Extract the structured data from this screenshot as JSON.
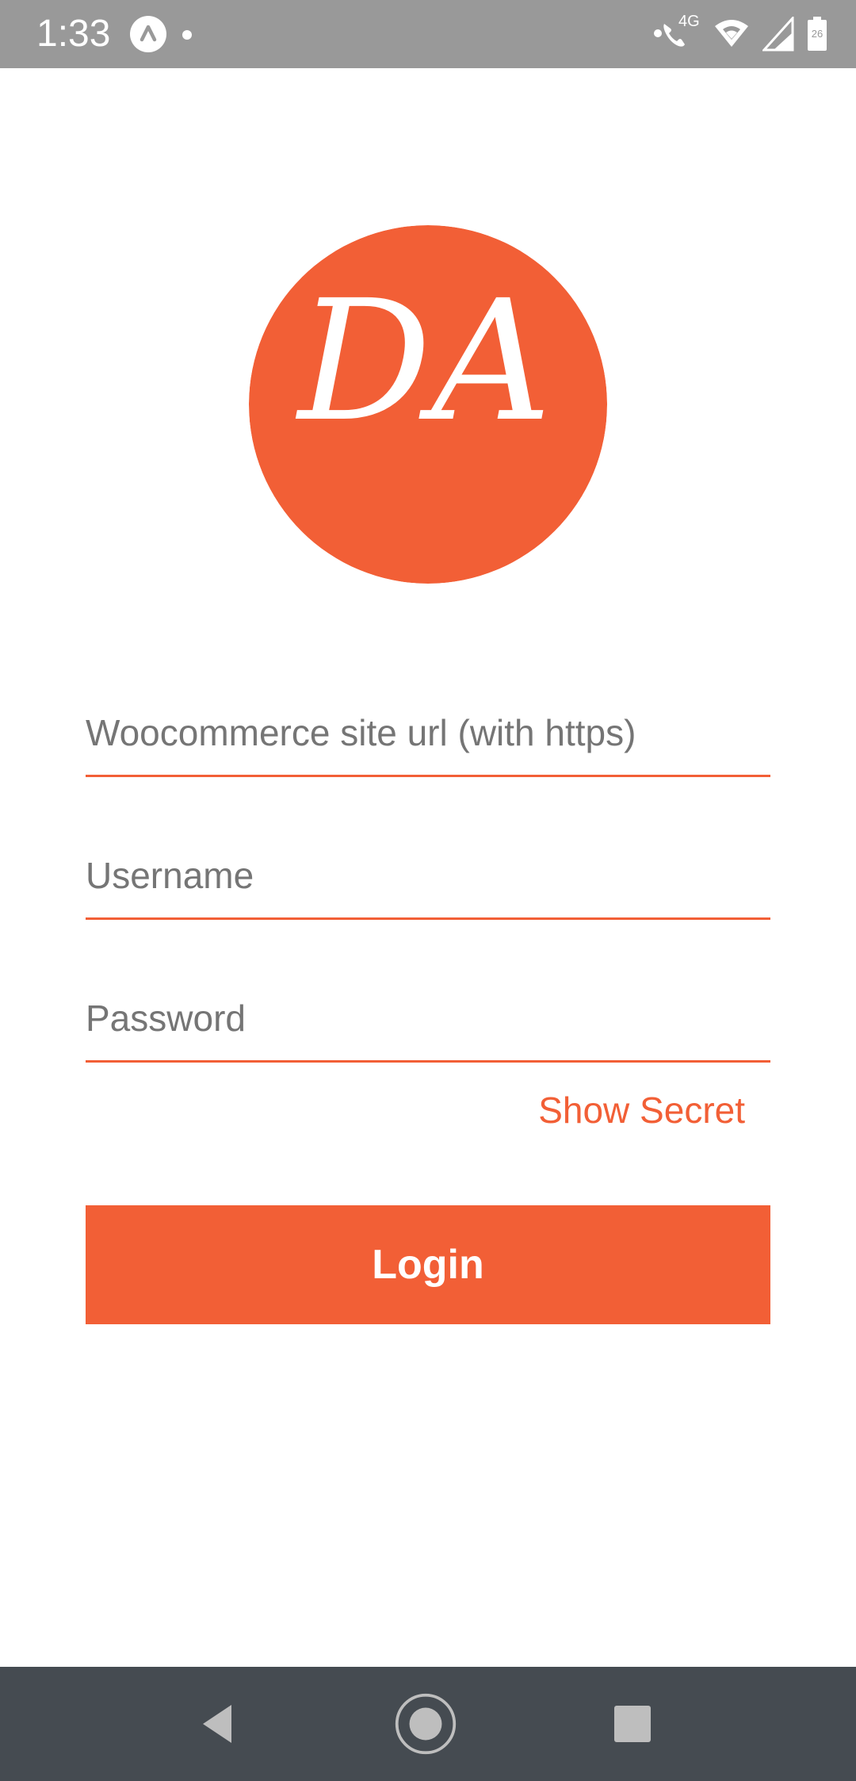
{
  "status_bar": {
    "time": "1:33",
    "network_label": "4G",
    "battery_level": "26",
    "icons": [
      "app-icon",
      "notification-dot",
      "volte-call-icon",
      "wifi-icon",
      "signal-icon",
      "battery-icon"
    ]
  },
  "logo": {
    "text": "DA"
  },
  "form": {
    "site_url_placeholder": "Woocommerce site url (with https)",
    "username_placeholder": "Username",
    "password_placeholder": "Password",
    "show_secret_label": "Show Secret",
    "login_label": "Login"
  },
  "nav_bar": {
    "icons": [
      "back-icon",
      "home-icon",
      "recents-icon"
    ]
  },
  "colors": {
    "accent": "#F25F36",
    "status_bar": "#999999",
    "nav_bar": "#454B51",
    "nav_icons": "#BEBEBE",
    "background": "#FFFFFF"
  }
}
